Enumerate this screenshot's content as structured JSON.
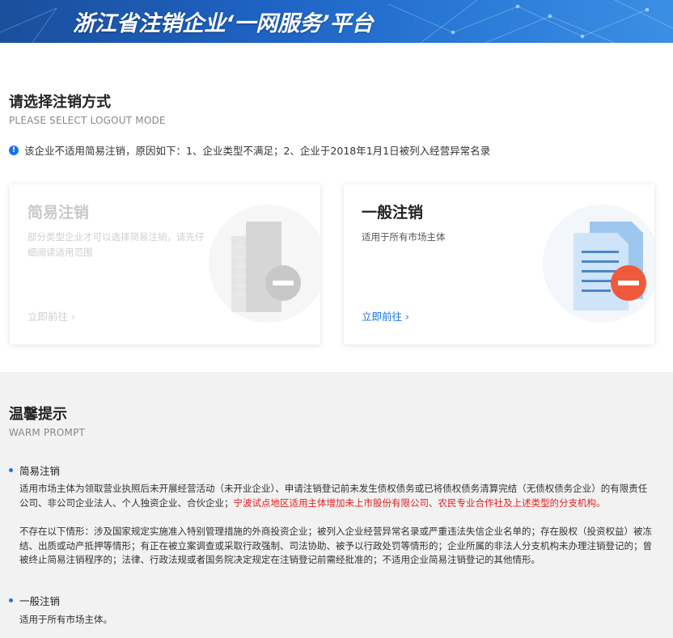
{
  "header": {
    "title": "浙江省注销企业‘一网服务’平台"
  },
  "select_section": {
    "title": "请选择注销方式",
    "subtitle": "PLEASE SELECT LOGOUT MODE"
  },
  "notice": {
    "icon": "info-icon",
    "text": "该企业不适用简易注销，原因如下：1、企业类型不满足；2、企业于2018年1月1日被列入经营异常名录"
  },
  "cards": [
    {
      "title": "简易注销",
      "desc": "部分类型企业才可以选择简易注销，请先仔细阅读适用范围",
      "link": "立即前往 ›",
      "state": "disabled",
      "icon": "building-minus-icon"
    },
    {
      "title": "一般注销",
      "desc": "适用于所有市场主体",
      "link": "立即前往 ›",
      "state": "enabled",
      "icon": "document-minus-icon"
    }
  ],
  "warm_prompt": {
    "title": "温馨提示",
    "subtitle": "WARM PROMPT",
    "items": [
      {
        "title": "简易注销",
        "para1_normal": "适用市场主体为领取营业执照后未开展经营活动（未开业企业）、申请注销登记前未发生债权债务或已将债权债务清算完结（无债权债务企业）的有限责任公司、非公司企业法人、个人独资企业、合伙企业；",
        "para1_red": "宁波试点地区适用主体增加未上市股份有限公司、农民专业合作社及上述类型的分支机构。",
        "para2": "不存在以下情形：涉及国家规定实施准入特别管理措施的外商投资企业；被列入企业经营异常名录或严重违法失信企业名单的；存在股权（投资权益）被冻结、出质或动产抵押等情形；有正在被立案调查或采取行政强制、司法协助、被予以行政处罚等情形的；企业所属的非法人分支机构未办理注销登记的；曾被终止简易注销程序的；法律、行政法规或者国务院决定规定在注销登记前需经批准的；不适用企业简易注销登记的其他情形。"
      },
      {
        "title": "一般注销",
        "para1_normal": "适用于所有市场主体。"
      }
    ]
  },
  "colors": {
    "accent": "#1b73e8",
    "warning_red": "#e02020",
    "banner": "#1e63c4"
  }
}
